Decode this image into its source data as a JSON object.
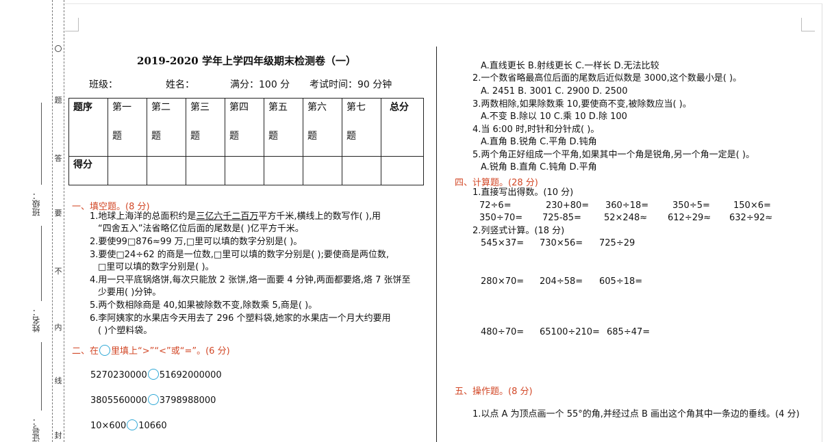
{
  "binding": {
    "class_label": "班级：",
    "name_label": "姓名：",
    "id_label": "证号：",
    "seal_chars": [
      "题",
      "答",
      "要",
      "不",
      "内",
      "线",
      "封"
    ]
  },
  "header": {
    "title": "2019-2020 学年上学四年级期末检测卷（一）",
    "class_field": "班级：",
    "name_field": "姓名：",
    "full_score": "满分：100 分",
    "exam_time": "考试时间：90 分钟"
  },
  "score_table": {
    "row1_label": "题序",
    "columns": [
      {
        "top": "第一",
        "bottom": "题"
      },
      {
        "top": "第二",
        "bottom": "题"
      },
      {
        "top": "第三",
        "bottom": "题"
      },
      {
        "top": "第四",
        "bottom": "题"
      },
      {
        "top": "第五",
        "bottom": "题"
      },
      {
        "top": "第六",
        "bottom": "题"
      },
      {
        "top": "第七",
        "bottom": "题"
      }
    ],
    "total_label": "总分",
    "row2_label": "得分"
  },
  "section1": {
    "title": "一、填空题。(8 分)",
    "q1_a": "1.地球上海洋的总面积约是",
    "q1_ul": "三亿六千二百万",
    "q1_b": "平方千米,横线上的数写作(          ),用",
    "q1_c": "“四舍五入”法省略亿位后面的尾数是(          )亿平方千米。",
    "q2": "2.要使99□876≈99 万,□里可以填的数字分别是(                 )。",
    "q3_a": "3.要使□24÷62 的商是一位数,□里可以填的数字分别是(       );要使商是两位数,",
    "q3_b": "□里可以填的数字分别是(       )。",
    "q4_a": "4.用一只平底锅烙饼,每次只能放 2 张饼,烙一面要 4 分钟,两面都要烙,烙 7 张饼至",
    "q4_b": "少要用(       )分钟。",
    "q5": "5.两个数相除商是 40,如果被除数不变,除数乘 5,商是(       )。",
    "q6_a": "6.李阿姨家的水果店今天用去了 296 个塑料袋,她家的水果店一个月大约要用",
    "q6_b": "(       )个塑料袋。"
  },
  "section2": {
    "title_a": "二、在",
    "title_b": "里填上“>”“<”或“=”。(6 分)",
    "c1_left": "5270230000",
    "c1_right": "51692000000",
    "c2_left": "3805560000",
    "c2_right": "3798988000",
    "c3_left": "10×600",
    "c3_right": "10660"
  },
  "section3_cont": {
    "q1_opts": "A.直线更长   B.射线更长        C.一样长        D.无法比较",
    "q2": "2.一个数省略最高位后面的尾数后近似数是 3000,这个数最小是(       )。",
    "q2_opts": "A. 2451          B. 3001              C. 2900        D. 2500",
    "q3": "3.两数相除,如果除数乘 10,要使商不变,被除数应当(       )。",
    "q3_opts": "A.不变           B.除以 10            C.乘 10        D.除 100",
    "q4": "4.当 6:00 时,时针和分针成(       )。",
    "q4_opts": "A.直角           B.锐角                 C.平角         D.钝角",
    "q5": "5.两个角正好组成一个平角,如果其中一个角是锐角,另一个角一定是(       )。",
    "q5_opts": "A.锐角           B.直角                 C.钝角         D.平角"
  },
  "section4": {
    "title": "四、计算题。(28 分)",
    "sub1": "1.直接写出得数。(10 分)",
    "row1": [
      "72÷6=",
      "230+80=",
      "360÷18=",
      "350÷5=",
      "150×6="
    ],
    "row2": [
      "350÷70=",
      "725-85=",
      "52×248≈",
      "612÷29≈",
      "632÷92≈"
    ],
    "sub2": "2.列竖式计算。(18 分)",
    "v1": [
      "545×37=",
      "730×56=",
      "725÷29"
    ],
    "v2": [
      "280×70=",
      "204÷58=",
      "605÷18="
    ],
    "v3": [
      "480÷70=",
      "65100÷210=",
      "685÷47="
    ]
  },
  "section5": {
    "title": "五、操作题。(8 分)",
    "q1": "1.以点 A 为顶点画一个 55°的角,并经过点 B 画出这个角其中一条边的垂线。(4 分)"
  }
}
